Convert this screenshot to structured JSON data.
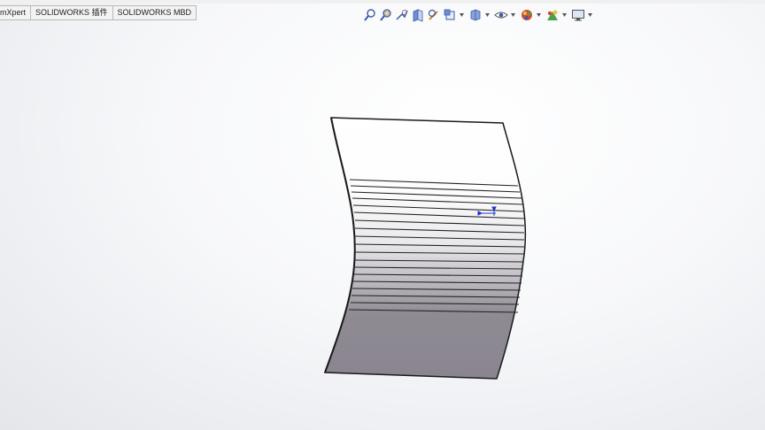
{
  "command_tabs": [
    {
      "label": "mXpert"
    },
    {
      "label": "SOLIDWORKS 插件"
    },
    {
      "label": "SOLIDWORKS MBD"
    }
  ],
  "heads_up_toolbar": [
    {
      "icon": "zoom-to-fit-icon"
    },
    {
      "icon": "zoom-to-area-icon"
    },
    {
      "icon": "previous-view-icon"
    },
    {
      "icon": "section-view-icon"
    },
    {
      "icon": "dynamic-annotation-views-icon"
    },
    {
      "icon": "view-orientation-icon"
    },
    {
      "icon": "display-style-icon"
    },
    {
      "icon": "hide-show-items-icon"
    },
    {
      "icon": "edit-appearance-icon"
    },
    {
      "icon": "apply-scene-icon"
    },
    {
      "icon": "view-settings-icon"
    }
  ],
  "colors": {
    "sheet_top": "#ffffff",
    "sheet_bottom": "#8d8892",
    "edge": "#1a1a1a",
    "triad": "#1f2fd6"
  }
}
